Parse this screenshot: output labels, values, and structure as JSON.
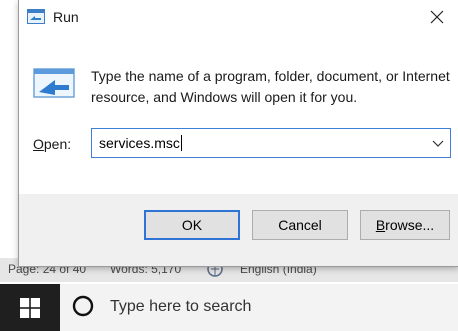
{
  "statusbar": {
    "page": "Page: 24 of 40",
    "words": "Words: 5,170",
    "language": "English (India)"
  },
  "dialog": {
    "title": "Run",
    "description": "Type the name of a program, folder, document, or Internet resource, and Windows will open it for you.",
    "open_label_hotkey": "O",
    "open_label_rest": "pen:",
    "open_value": "services.msc",
    "buttons": {
      "ok": "OK",
      "cancel": "Cancel",
      "browse_hotkey": "B",
      "browse_rest": "rowse..."
    }
  },
  "taskbar": {
    "search_placeholder": "Type here to search"
  },
  "colors": {
    "accent": "#2f73d4",
    "taskbar": "#1f1f1f",
    "dialog_footer": "#f0f0f0"
  },
  "icons": [
    "run-app-icon",
    "close-icon",
    "run-program-icon",
    "dropdown-chevron-icon",
    "windows-logo-icon",
    "cortana-circle-icon",
    "language-icon"
  ]
}
